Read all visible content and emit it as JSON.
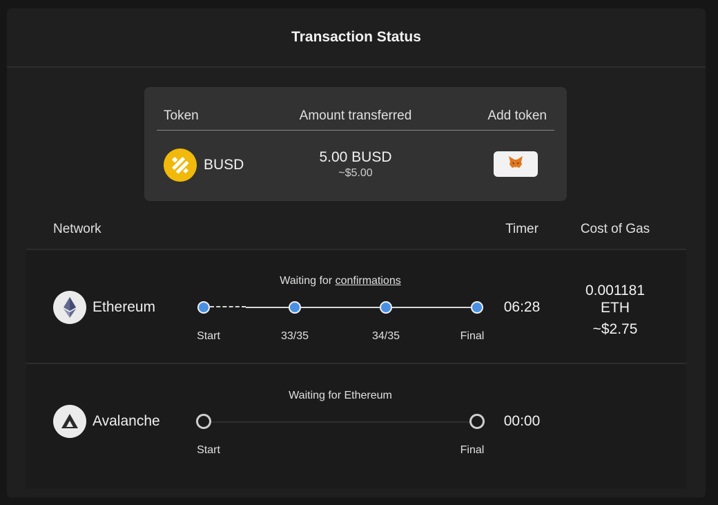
{
  "header": {
    "title": "Transaction Status"
  },
  "token_card": {
    "headers": {
      "token": "Token",
      "amount": "Amount transferred",
      "add": "Add token"
    },
    "token": {
      "symbol": "BUSD",
      "icon": "busd-logo-icon"
    },
    "amount": {
      "value": "5.00 BUSD",
      "usd": "~$5.00"
    },
    "add_button": {
      "icon": "metamask-fox-icon"
    },
    "colors": {
      "card": "#323232",
      "busd": "#f0b90b"
    }
  },
  "table": {
    "headers": {
      "network": "Network",
      "timer": "Timer",
      "gas": "Cost of Gas"
    }
  },
  "networks": [
    {
      "name": "Ethereum",
      "icon": "ethereum-icon",
      "status_prefix": "Waiting for ",
      "status_link": "confirmations",
      "steps": [
        "Start",
        "33/35",
        "34/35",
        "Final"
      ],
      "timer": "06:28",
      "gas_amount": "0.001181",
      "gas_unit": "ETH",
      "gas_usd": "~$2.75"
    },
    {
      "name": "Avalanche",
      "icon": "avalanche-icon",
      "status": "Waiting for Ethereum",
      "steps": [
        "Start",
        "Final"
      ],
      "timer": "00:00"
    }
  ],
  "colors": {
    "accent": "#4a90e2",
    "background": "#1f1f1f"
  }
}
